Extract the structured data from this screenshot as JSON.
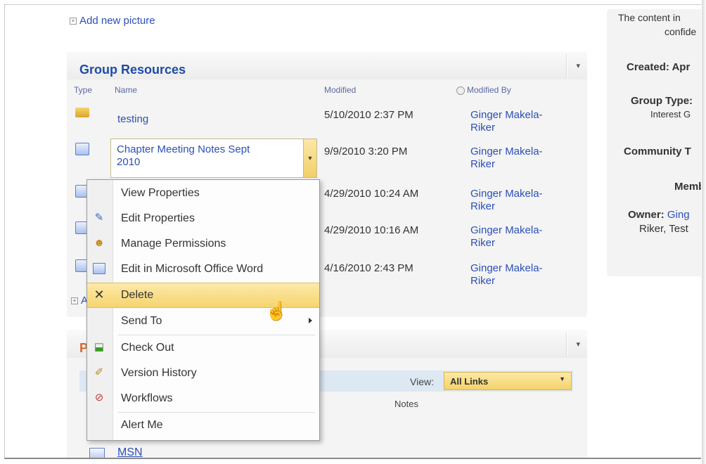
{
  "top": {
    "add_picture": "Add new picture"
  },
  "group_resources": {
    "title": "Group Resources",
    "columns": {
      "type": "Type",
      "name": "Name",
      "modified": "Modified",
      "modified_by": "Modified By"
    },
    "rows": [
      {
        "name": "testing",
        "modified": "5/10/2010 2:37 PM",
        "by1": "Ginger Makela-",
        "by2": "Riker"
      },
      {
        "name1": "Chapter Meeting Notes Sept",
        "name2": "2010",
        "modified": "9/9/2010 3:20 PM",
        "by1": "Ginger Makela-",
        "by2": "Riker"
      },
      {
        "modified": "4/29/2010 10:24 AM",
        "by1": "Ginger Makela-",
        "by2": "Riker"
      },
      {
        "modified": "4/29/2010 10:16 AM",
        "by1": "Ginger Makela-",
        "by2": "Riker"
      },
      {
        "modified": "4/16/2010 2:43 PM",
        "by1": "Ginger Makela-",
        "by2": "Riker"
      }
    ],
    "add_partial": "A"
  },
  "context_menu": {
    "items": [
      {
        "label": "View Properties",
        "icon": ""
      },
      {
        "label": "Edit Properties",
        "icon": "edit-properties-icon"
      },
      {
        "label": "Manage Permissions",
        "icon": "permissions-icon"
      },
      {
        "label": "Edit in Microsoft Office Word",
        "icon": "word-icon"
      },
      {
        "label": "Delete",
        "icon": "delete-icon"
      },
      {
        "label": "Send To",
        "icon": ""
      },
      {
        "label": "Check Out",
        "icon": "check-out-icon"
      },
      {
        "label": "Version History",
        "icon": "version-history-icon"
      },
      {
        "label": "Workflows",
        "icon": "workflows-icon"
      },
      {
        "label": "Alert Me",
        "icon": ""
      }
    ]
  },
  "links_part": {
    "title_partial": "P",
    "view_label": "View:",
    "view_value": "All Links",
    "notes_header": "Notes",
    "first_link": "MSN"
  },
  "right_panel": {
    "content_line1": "The content in",
    "content_line2": "confide",
    "created": "Created: Apr",
    "group_type": "Group Type:",
    "group_type_val": "Interest G",
    "community": "Community T",
    "members": "Membe",
    "owner": "Owner:",
    "owner_val1": "Ging",
    "owner_val2": "Riker, Test"
  },
  "colors": {
    "link": "#2b4fb7",
    "highlight": "#f6d46f",
    "title": "#1f4aa8"
  }
}
